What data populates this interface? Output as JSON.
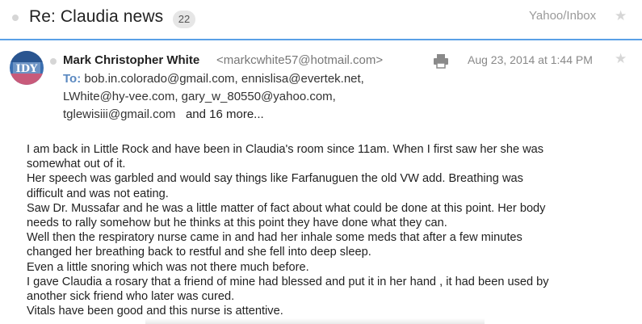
{
  "header": {
    "subject": "Re: Claudia news",
    "message_count": "22",
    "folder": "Yahoo/Inbox"
  },
  "message": {
    "sender_name": "Mark Christopher White",
    "sender_email": "<markcwhite57@hotmail.com>",
    "date": "Aug 23, 2014 at 1:44 PM",
    "to_label": "To:",
    "recipients_line1": "bob.in.colorado@gmail.com,   ennislisa@evertek.net,",
    "recipients_line2": "LWhite@hy-vee.com,   gary_w_80550@yahoo.com,",
    "recipients_line3": "tglewisiii@gmail.com",
    "more_recipients": "and 16 more...",
    "body": [
      "I am back in Little Rock and have been in Claudia's room since 11am. When I first saw her she was",
      "somewhat out of it.",
      "Her speech was garbled and would say things like Farfanuguen the old VW add. Breathing was",
      "difficult and was not eating.",
      "Saw Dr. Mussafar and he was a little matter of fact about what could be done at this point. Her body",
      "needs to rally somehow but he thinks at this point they have done what they can.",
      "Well then the respiratory nurse came in and had her inhale some meds that after a few minutes",
      "changed her breathing back to restful and she fell into deep sleep.",
      "Even a little snoring which was not there much before.",
      "I gave Claudia a rosary that a friend of mine had blessed and put it in her hand , it had been used by",
      "another sick friend who later was cured.",
      "Vitals have been good and this nurse is attentive."
    ]
  },
  "icons": {
    "header_dot": "unread-dot-icon",
    "header_star": "star-icon",
    "avatar": "avatar-image",
    "message_dot": "unread-dot-icon",
    "print": "printer-icon",
    "message_star": "star-icon"
  },
  "colors": {
    "accent_divider": "#5aa0e6",
    "to_label": "#5a88c0",
    "muted_text": "#9a9a9a"
  }
}
